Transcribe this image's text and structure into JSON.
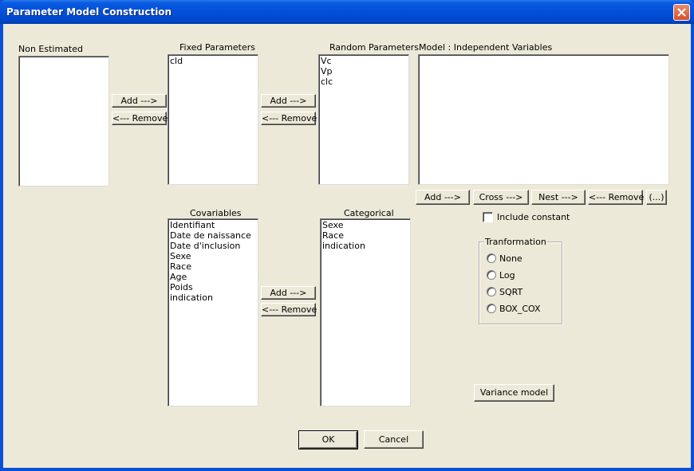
{
  "window": {
    "title": "Parameter Model Construction"
  },
  "non_estimated": {
    "label": "Non Estimated",
    "items": []
  },
  "fixed": {
    "label": "Fixed Parameters",
    "items": [
      "cld"
    ]
  },
  "random": {
    "label": "Random Parameters",
    "items": [
      "Vc",
      "Vp",
      "clc"
    ]
  },
  "model": {
    "label": "Model : Independent Variables",
    "items": []
  },
  "covariables": {
    "label": "Covariables",
    "items": [
      "Identifiant",
      "Date de naissance",
      "Date d'inclusion",
      "Sexe",
      "Race",
      "Age",
      "Poids",
      "indication"
    ]
  },
  "categorical": {
    "label": "Categorical",
    "items": [
      "Sexe",
      "Race",
      "indication"
    ]
  },
  "buttons": {
    "add": "Add --->",
    "remove": "<--- Remove",
    "cross": "Cross --->",
    "nest": "Nest --->",
    "ellipsis": "(...)",
    "variance_model": "Variance model",
    "ok": "OK",
    "cancel": "Cancel"
  },
  "include_constant": {
    "label": "Include constant",
    "checked": false
  },
  "transformation": {
    "title": "Tranformation",
    "options": [
      "None",
      "Log",
      "SQRT",
      "BOX_COX"
    ],
    "selected": null
  }
}
